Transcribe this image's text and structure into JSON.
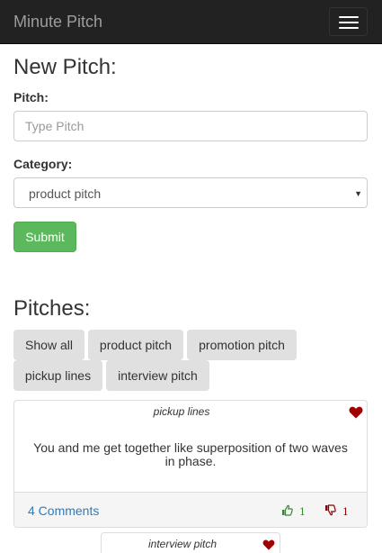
{
  "navbar": {
    "brand": "Minute Pitch",
    "toggle_icon": "hamburger-menu-icon"
  },
  "form": {
    "title": "New Pitch:",
    "pitch_label": "Pitch:",
    "pitch_placeholder": "Type Pitch",
    "pitch_value": "",
    "category_label": "Category:",
    "category_value": "product pitch",
    "submit_label": "Submit",
    "submit_color": "#5cb85c"
  },
  "pitches": {
    "title": "Pitches:",
    "categories": [
      "Show all",
      "product pitch",
      "promotion pitch",
      "pickup lines",
      "interview pitch"
    ]
  },
  "cards": [
    {
      "category": "pickup lines",
      "text": "You and me get together like superposition of two waves in phase.",
      "comments": "4 Comments",
      "upvotes": "1",
      "downvotes": "1",
      "favorite_icon": "heart-icon",
      "heart_color": "#a00000"
    },
    {
      "category": "interview pitch",
      "favorite_icon": "heart-icon"
    }
  ]
}
